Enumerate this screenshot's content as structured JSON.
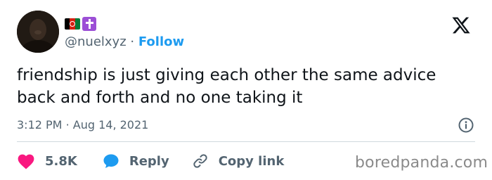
{
  "user": {
    "handle": "@nuelxyz",
    "separator": "·",
    "follow_label": "Follow",
    "badges": [
      "flag-icon-afghanistan",
      "latin-cross-icon"
    ]
  },
  "tweet": {
    "text": "friendship is just giving each other the same advice back and forth and no one taking it",
    "time": "3:12 PM",
    "date_separator": "·",
    "date": "Aug 14, 2021"
  },
  "actions": {
    "likes": "5.8K",
    "reply_label": "Reply",
    "copy_link_label": "Copy link"
  },
  "watermark": "boredpanda.com",
  "colors": {
    "accent": "#1d9bf0",
    "like": "#f91880",
    "text": "#0f1419",
    "muted": "#536471",
    "divider": "#cfd9de"
  },
  "icons": {
    "brand": "x-logo-icon",
    "info": "info-icon",
    "like": "heart-icon",
    "reply": "speech-bubble-icon",
    "copy": "link-icon"
  }
}
